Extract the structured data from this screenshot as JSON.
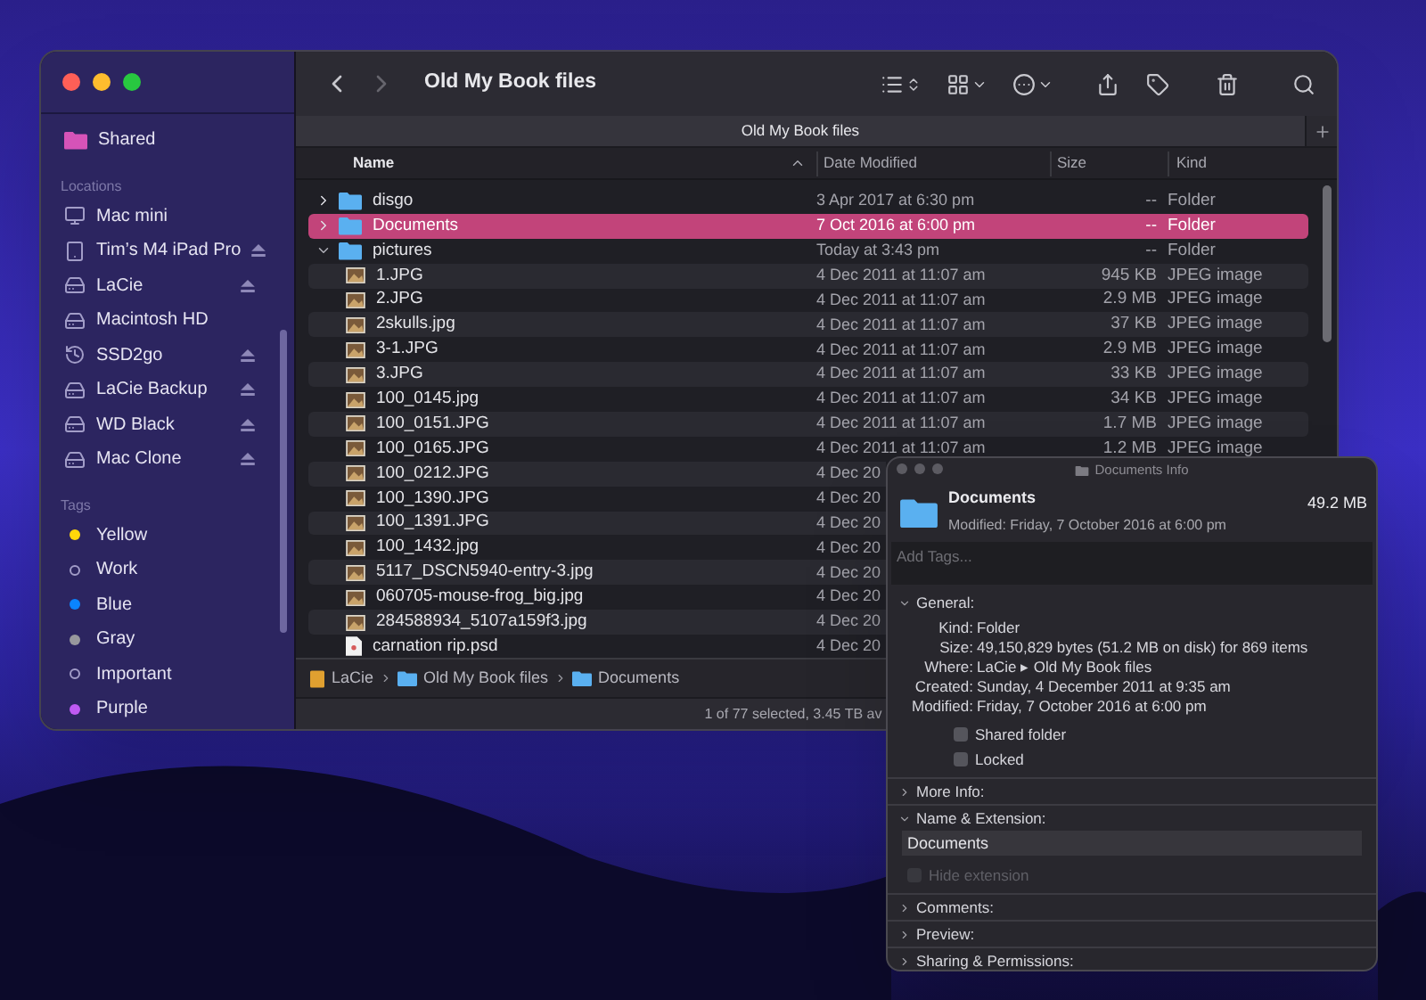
{
  "finder": {
    "sidebar": {
      "sections": [
        {
          "items": [
            {
              "label": "Shared",
              "kind": "shared",
              "ejectable": false
            }
          ]
        },
        {
          "title": "Locations",
          "items": [
            {
              "label": "Mac mini",
              "kind": "computer",
              "ejectable": false
            },
            {
              "label": "Tim’s M4 iPad Pro",
              "kind": "tablet",
              "ejectable": true
            },
            {
              "label": "LaCie",
              "kind": "drive",
              "ejectable": true
            },
            {
              "label": "Macintosh HD",
              "kind": "drive",
              "ejectable": false
            },
            {
              "label": "SSD2go",
              "kind": "backup",
              "ejectable": true
            },
            {
              "label": "LaCie Backup",
              "kind": "drive",
              "ejectable": true
            },
            {
              "label": "WD Black",
              "kind": "drive",
              "ejectable": true
            },
            {
              "label": "Mac Clone",
              "kind": "drive",
              "ejectable": true
            }
          ]
        },
        {
          "title": "Tags",
          "items": [
            {
              "label": "Yellow",
              "kind": "tag",
              "color": "#ffd60a"
            },
            {
              "label": "Work",
              "kind": "tag"
            },
            {
              "label": "Blue",
              "kind": "tag",
              "color": "#0a84ff"
            },
            {
              "label": "Gray",
              "kind": "tag",
              "color": "#98989d"
            },
            {
              "label": "Important",
              "kind": "tag"
            },
            {
              "label": "Purple",
              "kind": "tag",
              "color": "#bf5af2"
            }
          ]
        }
      ]
    },
    "toolbar": {
      "title": "Old My Book files",
      "nav": [
        {
          "kind": "back",
          "disabled": false
        },
        {
          "kind": "forward",
          "disabled": true
        }
      ]
    },
    "tab": {
      "label": "Old My Book files"
    },
    "columns": [
      {
        "label": "Name",
        "sorted": true
      },
      {
        "label": "Date Modified",
        "sorted": false
      },
      {
        "label": "Size",
        "sorted": false
      },
      {
        "label": "Kind",
        "sorted": false
      }
    ],
    "rows": [
      {
        "name": "disgo",
        "kind": "folder",
        "date": "3 Apr 2017 at 6:30 pm",
        "size": "--",
        "type": "Folder",
        "expanded": false,
        "selected": false
      },
      {
        "name": "Documents",
        "kind": "folder",
        "date": "7 Oct 2016 at 6:00 pm",
        "size": "--",
        "type": "Folder",
        "expanded": false,
        "selected": true
      },
      {
        "name": "pictures",
        "kind": "folder",
        "date": "Today at 3:43 pm",
        "size": "--",
        "type": "Folder",
        "expanded": true,
        "selected": false,
        "children": [
          {
            "name": "1.JPG",
            "kind": "image",
            "date": "4 Dec 2011 at 11:07 am",
            "size": "945 KB",
            "type": "JPEG image",
            "selected": false
          },
          {
            "name": "2.JPG",
            "kind": "image",
            "date": "4 Dec 2011 at 11:07 am",
            "size": "2.9 MB",
            "type": "JPEG image",
            "selected": false
          },
          {
            "name": "2skulls.jpg",
            "kind": "image",
            "date": "4 Dec 2011 at 11:07 am",
            "size": "37 KB",
            "type": "JPEG image",
            "selected": false
          },
          {
            "name": "3-1.JPG",
            "kind": "image",
            "date": "4 Dec 2011 at 11:07 am",
            "size": "2.9 MB",
            "type": "JPEG image",
            "selected": false
          },
          {
            "name": "3.JPG",
            "kind": "image",
            "date": "4 Dec 2011 at 11:07 am",
            "size": "33 KB",
            "type": "JPEG image",
            "selected": false
          },
          {
            "name": "100_0145.jpg",
            "kind": "image",
            "date": "4 Dec 2011 at 11:07 am",
            "size": "34 KB",
            "type": "JPEG image",
            "selected": false
          },
          {
            "name": "100_0151.JPG",
            "kind": "image",
            "date": "4 Dec 2011 at 11:07 am",
            "size": "1.7 MB",
            "type": "JPEG image",
            "selected": false
          },
          {
            "name": "100_0165.JPG",
            "kind": "image",
            "date": "4 Dec 2011 at 11:07 am",
            "size": "1.2 MB",
            "type": "JPEG image",
            "selected": false
          },
          {
            "name": "100_0212.JPG",
            "kind": "image",
            "date": "4 Dec 20",
            "selected": false
          },
          {
            "name": "100_1390.JPG",
            "kind": "image",
            "date": "4 Dec 20",
            "selected": false
          },
          {
            "name": "100_1391.JPG",
            "kind": "image",
            "date": "4 Dec 20",
            "selected": false
          },
          {
            "name": "100_1432.jpg",
            "kind": "image",
            "date": "4 Dec 20",
            "selected": false
          },
          {
            "name": "5117_DSCN5940-entry-3.jpg",
            "kind": "image",
            "date": "4 Dec 20",
            "selected": false
          },
          {
            "name": "060705-mouse-frog_big.jpg",
            "kind": "image",
            "date": "4 Dec 20",
            "selected": false
          },
          {
            "name": "284588934_5107a159f3.jpg",
            "kind": "image",
            "date": "4 Dec 20",
            "selected": false
          },
          {
            "name": "carnation rip.psd",
            "kind": "document",
            "date": "4 Dec 20",
            "selected": false
          }
        ]
      }
    ],
    "path": [
      {
        "label": "LaCie",
        "kind": "drive"
      },
      {
        "label": "Old My Book files",
        "kind": "folder"
      },
      {
        "label": "Documents",
        "kind": "folder"
      }
    ],
    "status": "1 of 77 selected, 3.45 TB av"
  },
  "info": {
    "title": "Documents Info",
    "name": "Documents",
    "size": "49.2 MB",
    "modified": "Modified: Friday, 7 October 2016 at 6:00 pm",
    "tags_placeholder": "Add Tags...",
    "sections": [
      {
        "title": "General:",
        "expanded": true,
        "rows": [
          {
            "label": "Kind:",
            "value": "Folder"
          },
          {
            "label": "Size:",
            "value": "49,150,829 bytes (51.2 MB on disk) for 869 items"
          },
          {
            "label": "Where:",
            "value": "LaCie ▸ Old My Book files"
          },
          {
            "label": "Created:",
            "value": "Sunday, 4 December 2011 at 9:35 am"
          },
          {
            "label": "Modified:",
            "value": "Friday, 7 October 2016 at 6:00 pm"
          }
        ],
        "checkboxes": [
          {
            "label": "Shared folder",
            "checked": false,
            "disabled": false
          },
          {
            "label": "Locked",
            "checked": false,
            "disabled": false
          }
        ]
      },
      {
        "title": "More Info:",
        "expanded": false
      },
      {
        "title": "Name & Extension:",
        "expanded": true,
        "field_value": "Documents",
        "checkboxes": [
          {
            "label": "Hide extension",
            "checked": false,
            "disabled": true
          }
        ]
      },
      {
        "title": "Comments:",
        "expanded": false
      },
      {
        "title": "Preview:",
        "expanded": false
      },
      {
        "title": "Sharing & Permissions:",
        "expanded": false
      }
    ]
  }
}
